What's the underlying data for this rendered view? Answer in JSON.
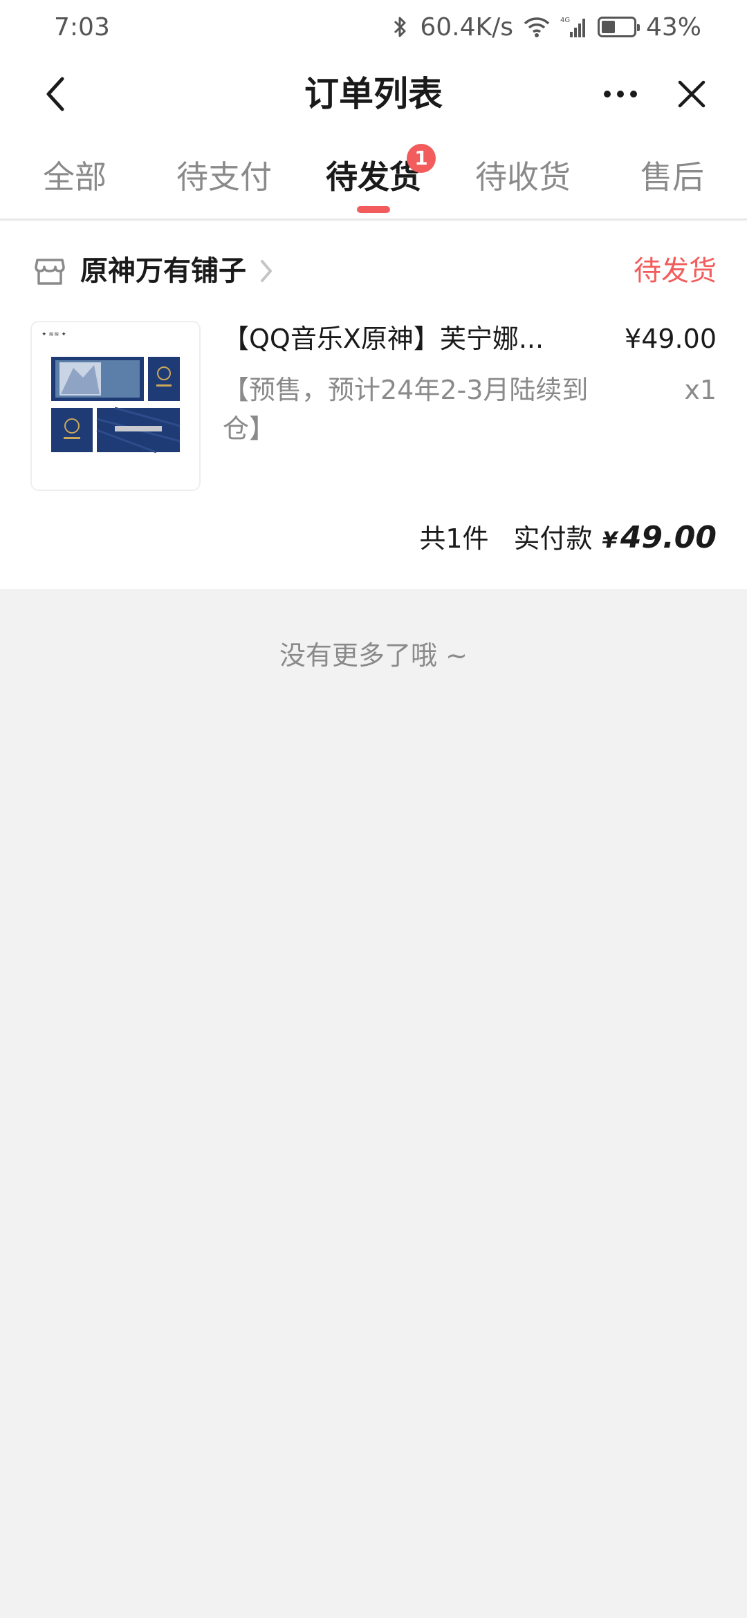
{
  "status_bar": {
    "time": "7:03",
    "net_speed": "60.4K/s",
    "network_type": "4G",
    "battery_percent": "43%",
    "battery_level": 0.43
  },
  "header": {
    "title": "订单列表"
  },
  "tabs": [
    {
      "label": "全部",
      "active": false
    },
    {
      "label": "待支付",
      "active": false
    },
    {
      "label": "待发货",
      "active": true,
      "badge": "1"
    },
    {
      "label": "待收货",
      "active": false
    },
    {
      "label": "售后",
      "active": false
    }
  ],
  "order": {
    "shop_name": "原神万有铺子",
    "status": "待发货",
    "product": {
      "title": "【QQ音乐X原神】芙宁娜...",
      "price": "¥49.00",
      "spec": "【预售，预计24年2-3月陆续到仓】",
      "quantity": "x1"
    },
    "summary": {
      "count": "共1件",
      "paid_label": "实付款",
      "currency": "¥",
      "amount": "49.00"
    }
  },
  "footer_text": "没有更多了哦 ~",
  "colors": {
    "accent": "#f25c5c",
    "text_primary": "#1a1a1a",
    "text_secondary": "#8a8a8a",
    "background": "#f2f2f2",
    "ticket_blue": "#1f3b75"
  },
  "icons": {
    "back": "chevron-left-icon",
    "more": "more-horizontal-icon",
    "close": "close-icon",
    "shop": "shop-icon",
    "shop_link": "chevron-right-icon",
    "bluetooth": "bluetooth-icon",
    "wifi": "wifi-icon",
    "signal": "signal-icon",
    "battery": "battery-icon"
  }
}
